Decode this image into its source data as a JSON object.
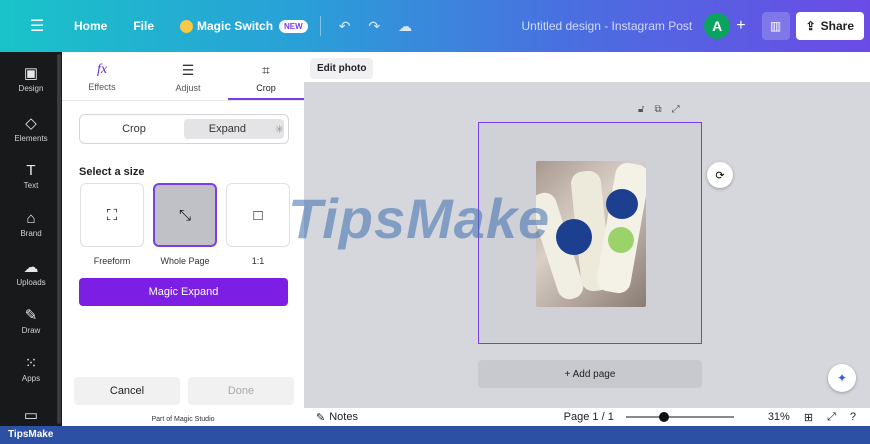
{
  "topbar": {
    "home": "Home",
    "file": "File",
    "magic_switch": "Magic Switch",
    "new_badge": "NEW",
    "doc_title": "Untitled design - Instagram Post",
    "avatar_letter": "A",
    "share": "Share"
  },
  "sidebar": {
    "items": [
      {
        "label": "Design",
        "icon": "layout-icon"
      },
      {
        "label": "Elements",
        "icon": "shapes-icon"
      },
      {
        "label": "Text",
        "icon": "text-icon"
      },
      {
        "label": "Brand",
        "icon": "brand-icon"
      },
      {
        "label": "Uploads",
        "icon": "cloud-upload-icon"
      },
      {
        "label": "Draw",
        "icon": "pen-icon"
      },
      {
        "label": "Apps",
        "icon": "grid-icon"
      }
    ]
  },
  "panel": {
    "tabs": [
      {
        "label": "Effects",
        "icon": "fx-icon"
      },
      {
        "label": "Adjust",
        "icon": "sliders-icon"
      },
      {
        "label": "Crop",
        "icon": "crop-icon"
      }
    ],
    "segment": {
      "crop": "Crop",
      "expand": "Expand"
    },
    "select_size": "Select a size",
    "sizes": [
      "Freeform",
      "Whole Page",
      "1:1"
    ],
    "magic_expand": "Magic Expand",
    "cancel": "Cancel",
    "done": "Done",
    "part_of": "Part of Magic Studio"
  },
  "canvas": {
    "edit_photo": "Edit photo",
    "add_page": "+ Add page"
  },
  "bottombar": {
    "notes": "Notes",
    "page": "Page 1 / 1",
    "zoom_level": 0.31,
    "zoom": "31%"
  },
  "watermark": "TipsMake",
  "footer": "TipsMake",
  "colors": {
    "accent": "#7c1ee3",
    "sidebar_bg": "#18191b",
    "canvas_bg": "#d6d7dc",
    "selection": "#7b3fe4"
  }
}
